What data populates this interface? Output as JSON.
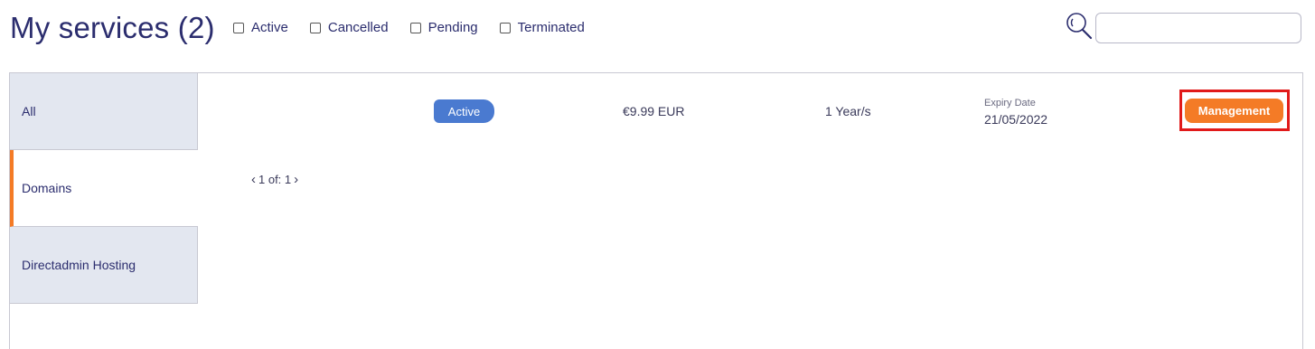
{
  "header": {
    "title": "My services (2)",
    "filters": [
      {
        "label": "Active",
        "checked": false
      },
      {
        "label": "Cancelled",
        "checked": false
      },
      {
        "label": "Pending",
        "checked": false
      },
      {
        "label": "Terminated",
        "checked": false
      }
    ],
    "search": {
      "icon": "search-icon",
      "value": ""
    }
  },
  "sidebar": {
    "items": [
      {
        "label": "All",
        "active": false
      },
      {
        "label": "Domains",
        "active": true
      },
      {
        "label": "Directadmin Hosting",
        "active": false
      }
    ]
  },
  "service": {
    "status": "Active",
    "price": "€9.99 EUR",
    "billing_cycle": "1 Year/s",
    "expiry_label": "Expiry Date",
    "expiry_value": "21/05/2022",
    "action_label": "Management"
  },
  "pagination": {
    "prev_icon": "chevron-left-icon",
    "text": "1 of: 1",
    "next_icon": "chevron-right-icon"
  },
  "colors": {
    "title": "#2b2d6e",
    "accent": "#f47b26",
    "status_active": "#4a7ad0",
    "sidebar_bg": "#e3e7f0",
    "highlight": "#e11a1a"
  }
}
